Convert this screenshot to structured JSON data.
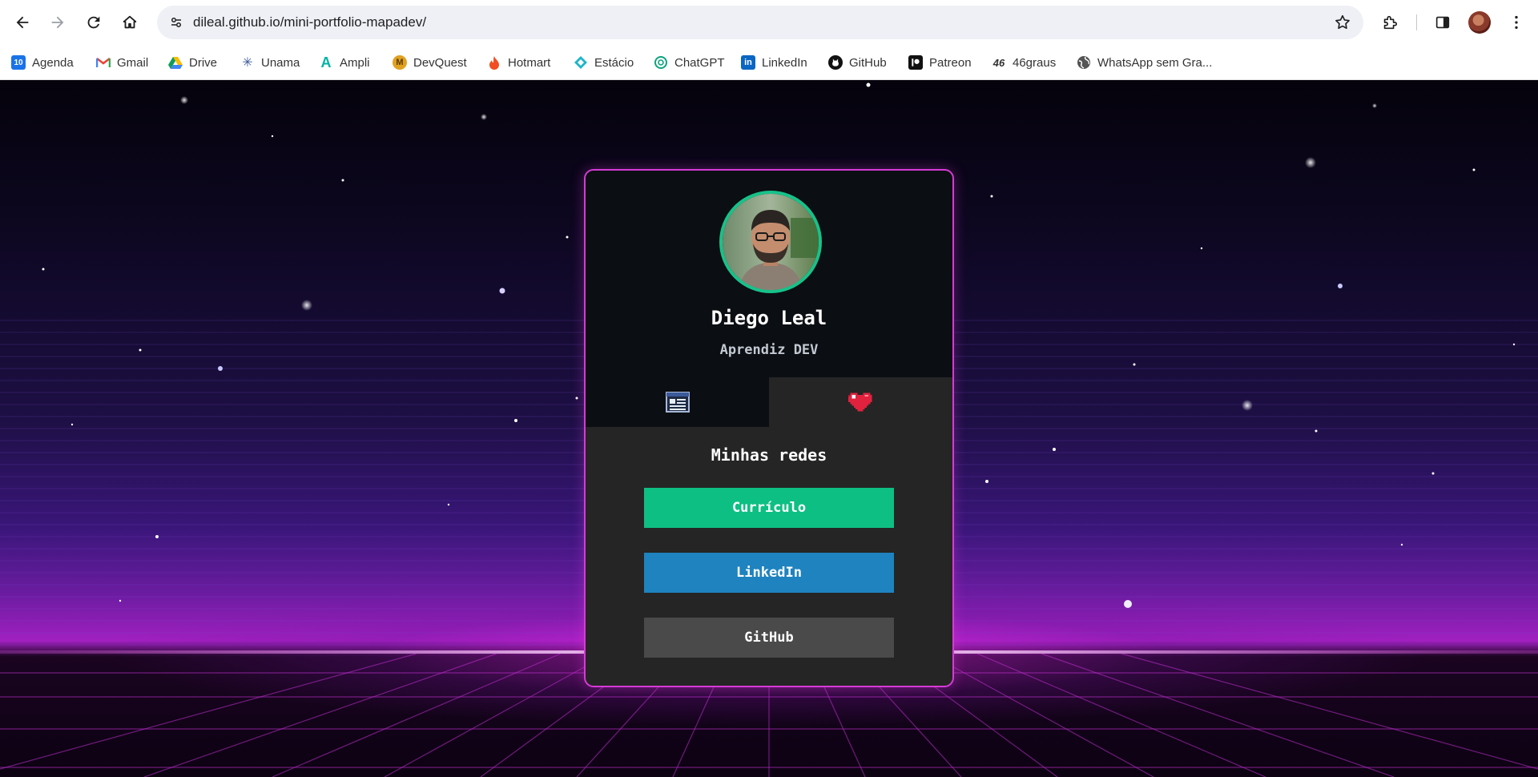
{
  "browser": {
    "url": "dileal.github.io/mini-portfolio-mapadev/",
    "bookmarks": [
      {
        "label": "Agenda",
        "icon": "calendar-icon",
        "color": "#1a73e8"
      },
      {
        "label": "Gmail",
        "icon": "gmail-icon",
        "color": "#ea4335"
      },
      {
        "label": "Drive",
        "icon": "drive-icon",
        "color": "#fbbc04"
      },
      {
        "label": "Unama",
        "icon": "unama-icon",
        "color": "#3c5a9a"
      },
      {
        "label": "Ampli",
        "icon": "ampli-icon",
        "color": "#00b3a4"
      },
      {
        "label": "DevQuest",
        "icon": "devquest-icon",
        "color": "#e0a020"
      },
      {
        "label": "Hotmart",
        "icon": "hotmart-icon",
        "color": "#f04e23"
      },
      {
        "label": "Estácio",
        "icon": "estacio-icon",
        "color": "#1fb5c8"
      },
      {
        "label": "ChatGPT",
        "icon": "chatgpt-icon",
        "color": "#10a37f"
      },
      {
        "label": "LinkedIn",
        "icon": "linkedin-icon",
        "color": "#0a66c2"
      },
      {
        "label": "GitHub",
        "icon": "github-icon",
        "color": "#111111"
      },
      {
        "label": "Patreon",
        "icon": "patreon-icon",
        "color": "#111111"
      },
      {
        "label": "46graus",
        "icon": "46graus-icon",
        "color": "#333333"
      },
      {
        "label": "WhatsApp sem Gra...",
        "icon": "globe-icon",
        "color": "#555555"
      }
    ]
  },
  "profile": {
    "name": "Diego Leal",
    "role": "Aprendiz DEV"
  },
  "tabs": [
    {
      "name": "resume-tab",
      "icon": "document-window-icon"
    },
    {
      "name": "favorites-tab",
      "icon": "pixel-heart-icon"
    }
  ],
  "links": {
    "title": "Minhas redes",
    "buttons": [
      {
        "label": "Currículo",
        "color": "#0ebf83"
      },
      {
        "label": "LinkedIn",
        "color": "#1e83bf"
      },
      {
        "label": "GitHub",
        "color": "#4a4a4a"
      }
    ]
  },
  "theme": {
    "card_border": "#d63bd6",
    "avatar_ring": "#17c28a",
    "card_bg": "#252525",
    "card_head_bg": "#0b0e12"
  }
}
